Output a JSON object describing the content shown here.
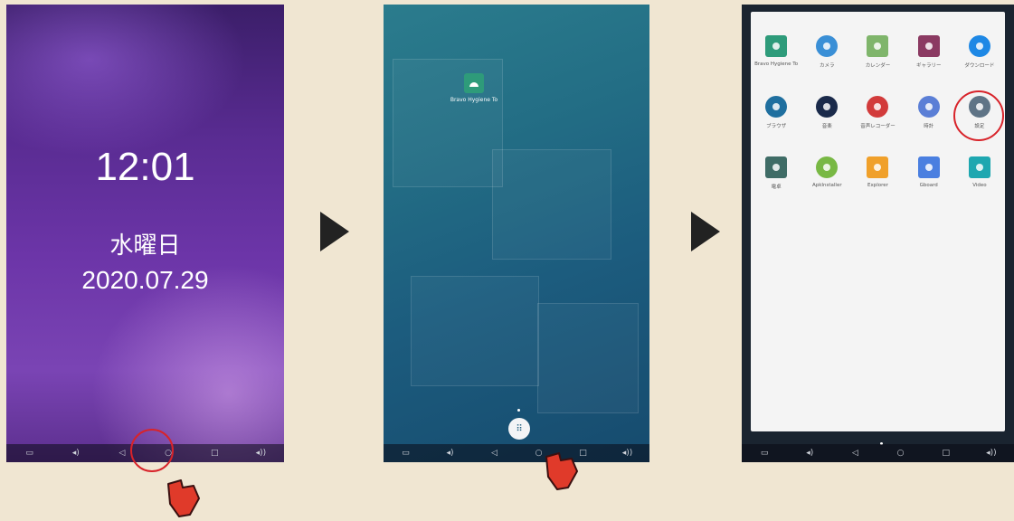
{
  "lock": {
    "time": "12:01",
    "weekday": "水曜日",
    "date": "2020.07.29"
  },
  "home": {
    "shortcut_label": "Bravo Hygiene To"
  },
  "drawer": {
    "apps": [
      {
        "label": "Bravo Hygiene To",
        "icon": "android-app-icon",
        "color": "#2e9b7a",
        "shape": "square"
      },
      {
        "label": "カメラ",
        "icon": "camera-icon",
        "color": "#3a8fd6",
        "shape": "round"
      },
      {
        "label": "カレンダー",
        "icon": "calendar-icon",
        "color": "#7fb56b",
        "shape": "square"
      },
      {
        "label": "ギャラリー",
        "icon": "gallery-icon",
        "color": "#8b3a62",
        "shape": "square"
      },
      {
        "label": "ダウンロード",
        "icon": "download-icon",
        "color": "#1e88e5",
        "shape": "round"
      },
      {
        "label": "ブラウザ",
        "icon": "browser-icon",
        "color": "#1f6f9f",
        "shape": "round"
      },
      {
        "label": "音楽",
        "icon": "music-icon",
        "color": "#1a2a4a",
        "shape": "round"
      },
      {
        "label": "音声レコーダー",
        "icon": "mic-icon",
        "color": "#d23b3b",
        "shape": "round"
      },
      {
        "label": "時計",
        "icon": "clock-icon",
        "color": "#5b7fd6",
        "shape": "round"
      },
      {
        "label": "設定",
        "icon": "gear-icon",
        "color": "#5f7486",
        "shape": "round"
      },
      {
        "label": "電卓",
        "icon": "calculator-icon",
        "color": "#3f6c66",
        "shape": "square"
      },
      {
        "label": "ApkInstaller",
        "icon": "android-icon",
        "color": "#78b844",
        "shape": "round"
      },
      {
        "label": "Explorer",
        "icon": "folder-icon",
        "color": "#f0a02a",
        "shape": "square"
      },
      {
        "label": "Gboard",
        "icon": "keyboard-icon",
        "color": "#4a7fe0",
        "shape": "square"
      },
      {
        "label": "Video",
        "icon": "play-icon",
        "color": "#1ea7b0",
        "shape": "square"
      }
    ]
  },
  "colors": {
    "highlight": "#d8232a",
    "pointer": "#e03a2a",
    "arrow": "#222222"
  }
}
